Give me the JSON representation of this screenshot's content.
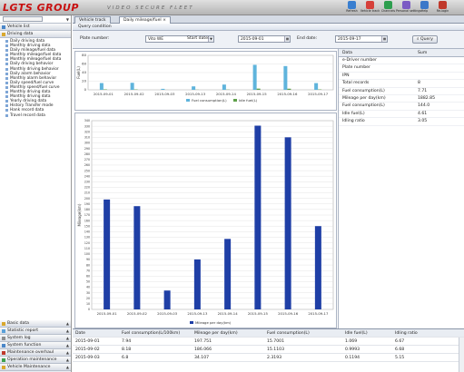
{
  "app": {
    "logo": "LGTS GROUP",
    "slogan": "VIDEO SECURE FLEET"
  },
  "toolbar": [
    {
      "label": "Refresh",
      "color": "#3a7fd0"
    },
    {
      "label": "Vehicle track",
      "color": "#d6403a"
    },
    {
      "label": "Channels",
      "color": "#2e9e4f"
    },
    {
      "label": "Personal settings",
      "color": "#7b5bc4"
    },
    {
      "label": "Help",
      "color": "#3b78c9"
    },
    {
      "label": "Re-login",
      "color": "#c0392b"
    }
  ],
  "sidebar": {
    "top": {
      "search_placeholder": "",
      "vehicle_list": "Vehicle list",
      "driving_data": "Driving data"
    },
    "items": [
      "Daily driving data",
      "Monthly driving data",
      "Daily mileage/fuel data",
      "Monthly mileage/fuel data",
      "Monthly mileage/fuel data",
      "Daily driving behavior",
      "Monthly driving behavior",
      "Daily alarm behavior",
      "Monthly alarm behavior",
      "Daily speed/fuel curve",
      "Monthly speed/fuel curve",
      "Monthly driving data",
      "Monthly driving data",
      "Yearly driving data",
      "History Transfer mode",
      "Hank record data",
      "Travel record data"
    ],
    "bottom": [
      "Basic data",
      "Statistic report",
      "System log",
      "System function",
      "Maintenance overhaul",
      "Operation maintenance",
      "Vehicle Maintenance"
    ]
  },
  "tabs": [
    "Vehicle track",
    "Daily mileage/fuel"
  ],
  "query": {
    "header": "Query condition",
    "plate_label": "Plate number:",
    "plate_value": "Vito WE",
    "start_label": "Start date:",
    "start_value": "2015-09-01",
    "end_label": "End date:",
    "end_value": "2015-09-17",
    "button": "Query"
  },
  "fuel_chart": {
    "ylabel": "Fuel(L)",
    "legend": [
      "Fuel consumption(L)",
      "Idle fuel(L)"
    ]
  },
  "mileage_chart": {
    "ylabel": "Mileage(km)",
    "legend": "Mileage per day(km)"
  },
  "chart_data": [
    {
      "type": "bar",
      "ylabel": "Fuel(L)",
      "categories": [
        "2015-09-01",
        "2015-09-02",
        "2015-09-03",
        "2015-09-13",
        "2015-09-14",
        "2015-09-15",
        "2015-09-16",
        "2015-09-17"
      ],
      "ylim": [
        0,
        80
      ],
      "yticks": [
        0,
        20,
        40,
        60,
        80
      ],
      "series": [
        {
          "name": "Fuel consumption(L)",
          "color": "#5fb4dc",
          "values": [
            15.7,
            16.3,
            2.3,
            8.0,
            12.2,
            58.0,
            55.1,
            15.6
          ]
        },
        {
          "name": "Idle fuel(L)",
          "color": "#5fa04a",
          "values": [
            1.0,
            0.8,
            0.1,
            0.3,
            0.5,
            2.8,
            2.6,
            0.9
          ]
        }
      ]
    },
    {
      "type": "bar",
      "ylabel": "Mileage(km)",
      "categories": [
        "2015-09-01",
        "2015-09-02",
        "2015-09-03",
        "2015-09-13",
        "2015-09-14",
        "2015-09-15",
        "2015-09-16",
        "2015-09-17"
      ],
      "ylim": [
        0,
        340
      ],
      "yticks": [
        0,
        10,
        20,
        30,
        40,
        50,
        60,
        70,
        80,
        90,
        100,
        110,
        120,
        130,
        140,
        150,
        160,
        170,
        180,
        190,
        200,
        210,
        220,
        230,
        240,
        250,
        260,
        270,
        280,
        290,
        300,
        310,
        320,
        330,
        340
      ],
      "series": [
        {
          "name": "Mileage per day(km)",
          "color": "#1f3fa6",
          "values": [
            198,
            186,
            34,
            90,
            127,
            331,
            310,
            150
          ]
        }
      ]
    }
  ],
  "summary": {
    "headers": [
      "Data",
      "Sum"
    ],
    "rows": [
      [
        "e-Driver number",
        ""
      ],
      [
        "Plate number",
        ""
      ],
      [
        "IPN",
        ""
      ],
      [
        "Total records",
        "8"
      ],
      [
        "Fuel consumption(L)",
        "7.71"
      ],
      [
        "Mileage per day(km)",
        "1882.85"
      ],
      [
        "Fuel consumption(L)",
        "144.0"
      ],
      [
        "Idle fuel(L)",
        "4.61"
      ],
      [
        "Idling ratio",
        "3.05"
      ]
    ]
  },
  "table": {
    "headers": [
      "Date",
      "Fuel consumption(L/100km)",
      "Mileage per day(km)",
      "Fuel consumption(L)",
      "Idle fuel(L)",
      "Idling ratio"
    ],
    "rows": [
      [
        "2015-09-01",
        "7.94",
        "197.751",
        "15.7001",
        "1.069",
        "6.67"
      ],
      [
        "2015-09-02",
        "8.18",
        "186.066",
        "15.1103",
        "0.9993",
        "6.68"
      ],
      [
        "2015-09-03",
        "6.8",
        "34.107",
        "2.3193",
        "0.1194",
        "5.15"
      ]
    ]
  }
}
